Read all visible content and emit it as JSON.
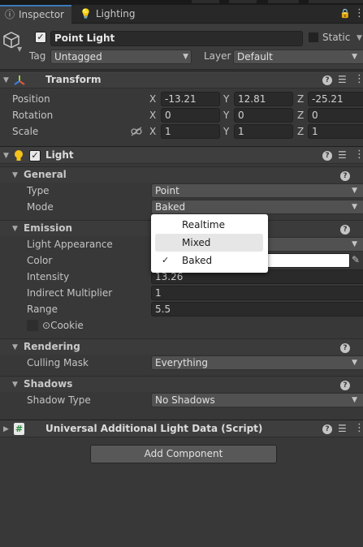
{
  "tabs": [
    {
      "label": "Inspector",
      "icon": "info-icon"
    },
    {
      "label": "Lighting",
      "icon": "lightbulb-icon"
    }
  ],
  "object": {
    "enabled": true,
    "name": "Point Light",
    "static_label": "Static",
    "static_checked": false,
    "tag_label": "Tag",
    "tag_value": "Untagged",
    "layer_label": "Layer",
    "layer_value": "Default"
  },
  "transform": {
    "title": "Transform",
    "position_label": "Position",
    "rotation_label": "Rotation",
    "scale_label": "Scale",
    "position": {
      "x": "-13.21",
      "y": "12.81",
      "z": "-25.21"
    },
    "rotation": {
      "x": "0",
      "y": "0",
      "z": "0"
    },
    "scale": {
      "x": "1",
      "y": "1",
      "z": "1"
    },
    "axis_x": "X",
    "axis_y": "Y",
    "axis_z": "Z"
  },
  "light": {
    "title": "Light",
    "enabled": true,
    "general": {
      "title": "General",
      "type_label": "Type",
      "type_value": "Point",
      "mode_label": "Mode",
      "mode_value": "Baked"
    },
    "emission": {
      "title": "Emission",
      "appearance_label": "Light Appearance",
      "color_label": "Color",
      "color_value": "#ffffff",
      "intensity_label": "Intensity",
      "intensity_value": "13.26",
      "indirect_label": "Indirect Multiplier",
      "indirect_value": "1",
      "range_label": "Range",
      "range_value": "5.5",
      "cookie_label": "Cookie",
      "cookie_prefix": "⊙"
    },
    "rendering": {
      "title": "Rendering",
      "culling_label": "Culling Mask",
      "culling_value": "Everything"
    },
    "shadows": {
      "title": "Shadows",
      "type_label": "Shadow Type",
      "type_value": "No Shadows"
    }
  },
  "additional": {
    "title": "Universal Additional Light Data (Script)"
  },
  "add_component_label": "Add Component",
  "mode_menu": {
    "options": [
      "Realtime",
      "Mixed",
      "Baked"
    ],
    "selected": "Baked",
    "highlighted": "Mixed",
    "check_glyph": "✓"
  },
  "colors": {
    "accent": "#3a79bb",
    "panel": "#383838",
    "x_axis": "#e05a3a",
    "y_axis": "#8fd14f",
    "z_axis": "#3a7ee0"
  }
}
